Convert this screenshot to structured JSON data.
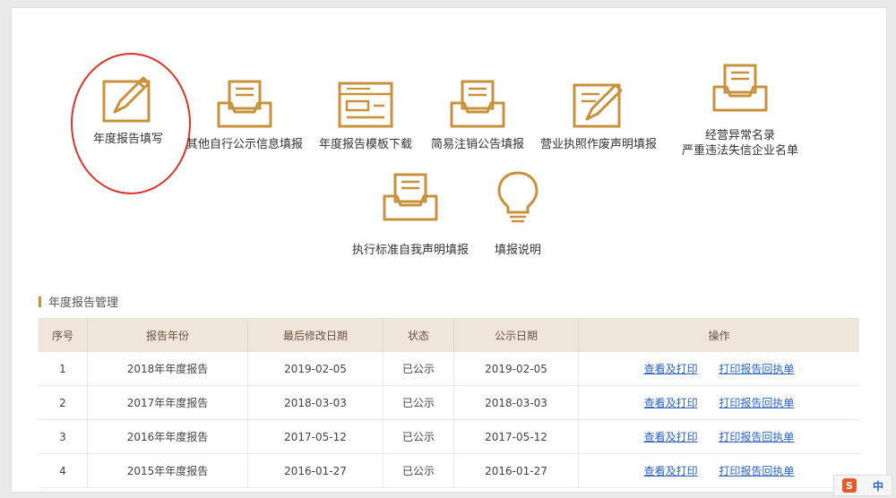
{
  "tiles": [
    {
      "label": "年度报告填写",
      "icon": "edit-pencil-icon"
    },
    {
      "label": "其他自行公示信息填报",
      "icon": "inbox-tray-icon"
    },
    {
      "label": "年度报告模板下载",
      "icon": "form-template-icon"
    },
    {
      "label": "简易注销公告填报",
      "icon": "inbox-tray-icon"
    },
    {
      "label": "营业执照作废声明填报",
      "icon": "edit-pencil-icon"
    },
    {
      "label": "经营异常名录",
      "label2": "严重违法失信企业名单",
      "icon": "inbox-tray-icon"
    },
    {
      "label": "执行标准自我声明填报",
      "icon": "inbox-tray-icon"
    },
    {
      "label": "填报说明",
      "icon": "lightbulb-icon"
    }
  ],
  "section": {
    "title": "年度报告管理"
  },
  "table": {
    "headers": [
      "序号",
      "报告年份",
      "最后修改日期",
      "状态",
      "公示日期",
      "操作"
    ],
    "rows": [
      {
        "no": "1",
        "year": "2018年年度报告",
        "modified": "2019-02-05",
        "status": "已公示",
        "published": "2019-02-05",
        "action1": "查看及打印",
        "action2": "打印报告回执单"
      },
      {
        "no": "2",
        "year": "2017年年度报告",
        "modified": "2018-03-03",
        "status": "已公示",
        "published": "2018-03-03",
        "action1": "查看及打印",
        "action2": "打印报告回执单"
      },
      {
        "no": "3",
        "year": "2016年年度报告",
        "modified": "2017-05-12",
        "status": "已公示",
        "published": "2017-05-12",
        "action1": "查看及打印",
        "action2": "打印报告回执单"
      },
      {
        "no": "4",
        "year": "2015年年度报告",
        "modified": "2016-01-27",
        "status": "已公示",
        "published": "2016-01-27",
        "action1": "查看及打印",
        "action2": "打印报告回执单"
      }
    ]
  },
  "ime": {
    "logo": "S",
    "mode": "中"
  },
  "colors": {
    "icon": "#c8923c",
    "highlight": "#d9342b",
    "link": "#2a63c5",
    "header_bg": "#f0e5db"
  }
}
